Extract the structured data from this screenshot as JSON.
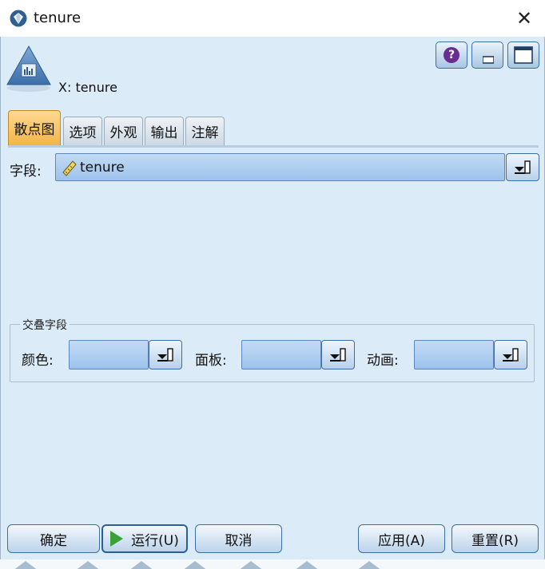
{
  "window": {
    "title": "tenure"
  },
  "header": {
    "node_label": "X: tenure"
  },
  "tabs": [
    {
      "label": "散点图",
      "active": true
    },
    {
      "label": "选项"
    },
    {
      "label": "外观"
    },
    {
      "label": "输出"
    },
    {
      "label": "注解"
    }
  ],
  "field": {
    "label": "字段:",
    "value": "tenure"
  },
  "overlay": {
    "title": "交叠字段",
    "color_label": "颜色:",
    "panel_label": "面板:",
    "animation_label": "动画:",
    "color_value": "",
    "panel_value": "",
    "animation_value": ""
  },
  "buttons": {
    "ok": "确定",
    "run": "运行(U)",
    "cancel": "取消",
    "apply": "应用(A)",
    "reset": "重置(R)"
  },
  "colors": {
    "panel_bg": "#dcebf8",
    "active_tab": "#f2b448",
    "combo_fill": "#9cc2ec",
    "help_icon": "#6a2c91",
    "run_icon": "#3aa13a"
  }
}
